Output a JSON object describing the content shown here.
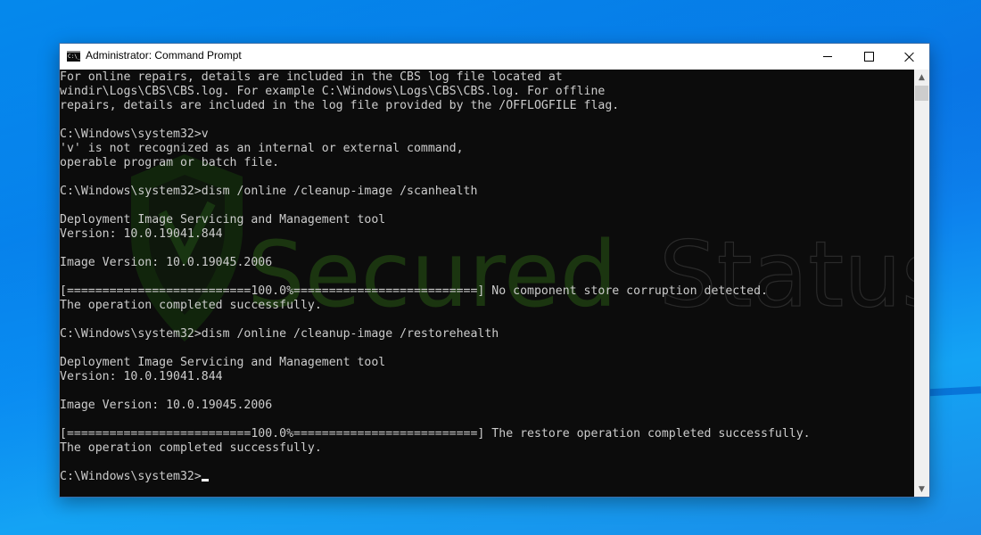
{
  "window": {
    "title": "Administrator: Command Prompt",
    "app_icon_text": "C:\\_",
    "controls": {
      "minimize": "minimize",
      "maximize": "maximize",
      "close": "close"
    }
  },
  "console": {
    "lines": [
      "For online repairs, details are included in the CBS log file located at",
      "windir\\Logs\\CBS\\CBS.log. For example C:\\Windows\\Logs\\CBS\\CBS.log. For offline",
      "repairs, details are included in the log file provided by the /OFFLOGFILE flag.",
      "",
      "C:\\Windows\\system32>v",
      "'v' is not recognized as an internal or external command,",
      "operable program or batch file.",
      "",
      "C:\\Windows\\system32>dism /online /cleanup-image /scanhealth",
      "",
      "Deployment Image Servicing and Management tool",
      "Version: 10.0.19041.844",
      "",
      "Image Version: 10.0.19045.2006",
      "",
      "[==========================100.0%==========================] No component store corruption detected.",
      "The operation completed successfully.",
      "",
      "C:\\Windows\\system32>dism /online /cleanup-image /restorehealth",
      "",
      "Deployment Image Servicing and Management tool",
      "Version: 10.0.19041.844",
      "",
      "Image Version: 10.0.19045.2006",
      "",
      "[==========================100.0%==========================] The restore operation completed successfully.",
      "The operation completed successfully.",
      "",
      "C:\\Windows\\system32>"
    ],
    "prompt": "C:\\Windows\\system32>",
    "scan_progress_percent": 100.0,
    "restore_progress_percent": 100.0
  },
  "watermark": {
    "text_part1": "Secured",
    "text_part2": "Status",
    "color": "#1d3a12"
  },
  "scrollbar": {
    "up_glyph": "⌃",
    "down_glyph": "⌄"
  }
}
